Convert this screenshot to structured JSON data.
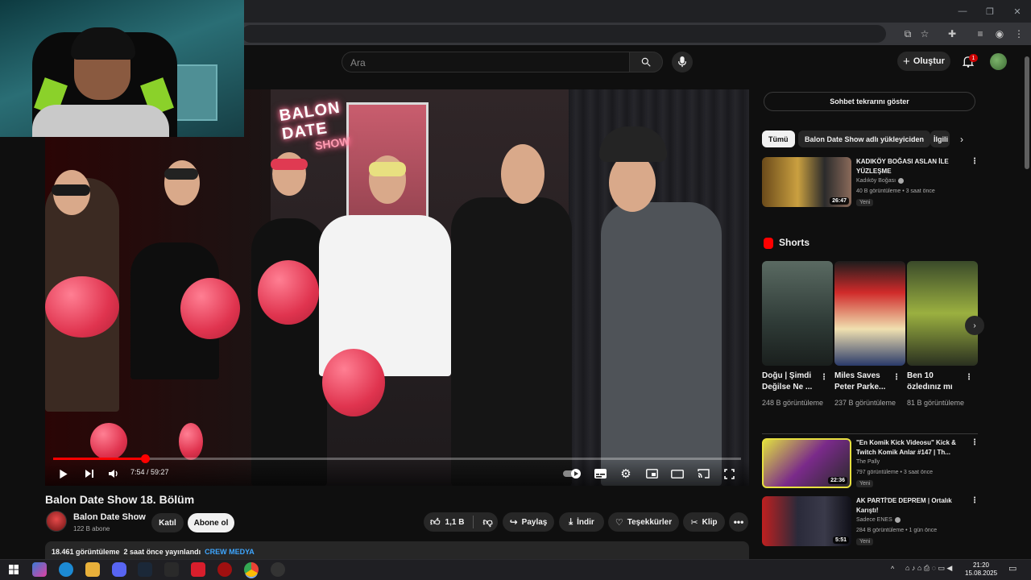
{
  "header": {
    "search_placeholder": "Ara",
    "create_label": "Oluştur",
    "notification_count": "1"
  },
  "video": {
    "sign_line1": "BALON DATE",
    "sign_line2": "SHOW",
    "time_current": "7:54",
    "time_total": "59:27",
    "time_display": "7:54 / 59:27",
    "progress_fraction": 0.133
  },
  "meta": {
    "title": "Balon Date Show 18. Bölüm",
    "channel": "Balon Date Show",
    "subscribers": "122 B abone",
    "join_label": "Katıl",
    "subscribe_label": "Abone ol",
    "likes": "1,1 B",
    "share_label": "Paylaş",
    "download_label": "İndir",
    "thanks_label": "Teşekkürler",
    "clip_label": "Klip",
    "views": "18.461 görüntüleme",
    "published": "2 saat önce yayınlandı",
    "tag": "CREW MEDYA"
  },
  "sidebar": {
    "chat_button": "Sohbet tekrarını göster",
    "chips": [
      "Tümü",
      "Balon Date Show adlı yükleyiciden",
      "İlgili"
    ],
    "shorts_title": "Shorts",
    "videos": [
      {
        "title": "KADIKÖY BOĞASI ASLAN İLE YÜZLEŞME",
        "channel": "Kadıköy Boğası",
        "meta": "40 B görüntüleme • 3 saat önce",
        "badge": "Yeni",
        "duration": "26:47",
        "verified": true
      },
      {
        "title": "\"En Komik Kick Videosu\" Kick & Twitch Komik Anlar #147 | Th...",
        "channel": "The Pally",
        "meta": "797 görüntüleme • 3 saat önce",
        "badge": "Yeni",
        "duration": "22:36",
        "verified": false
      },
      {
        "title": "AK PARTİ'DE DEPREM | Ortalık Karıştı!",
        "channel": "Sadece ENES",
        "meta": "284 B görüntüleme • 1 gün önce",
        "badge": "Yeni",
        "duration": "5:51",
        "verified": true
      }
    ],
    "shorts": [
      {
        "title": "Doğu | Şimdi Değilse Ne ...",
        "views": "248 B görüntüleme"
      },
      {
        "title": "Miles Saves Peter Parke...",
        "views": "237 B görüntüleme"
      },
      {
        "title": "Ben 10 özledınız mı",
        "views": "81 B görüntüleme"
      }
    ]
  },
  "taskbar": {
    "time": "21:20",
    "date": "15.08.2025"
  },
  "colors": {
    "accent": "#ff0000",
    "link": "#3ea6ff",
    "background": "#0f0f0f"
  }
}
